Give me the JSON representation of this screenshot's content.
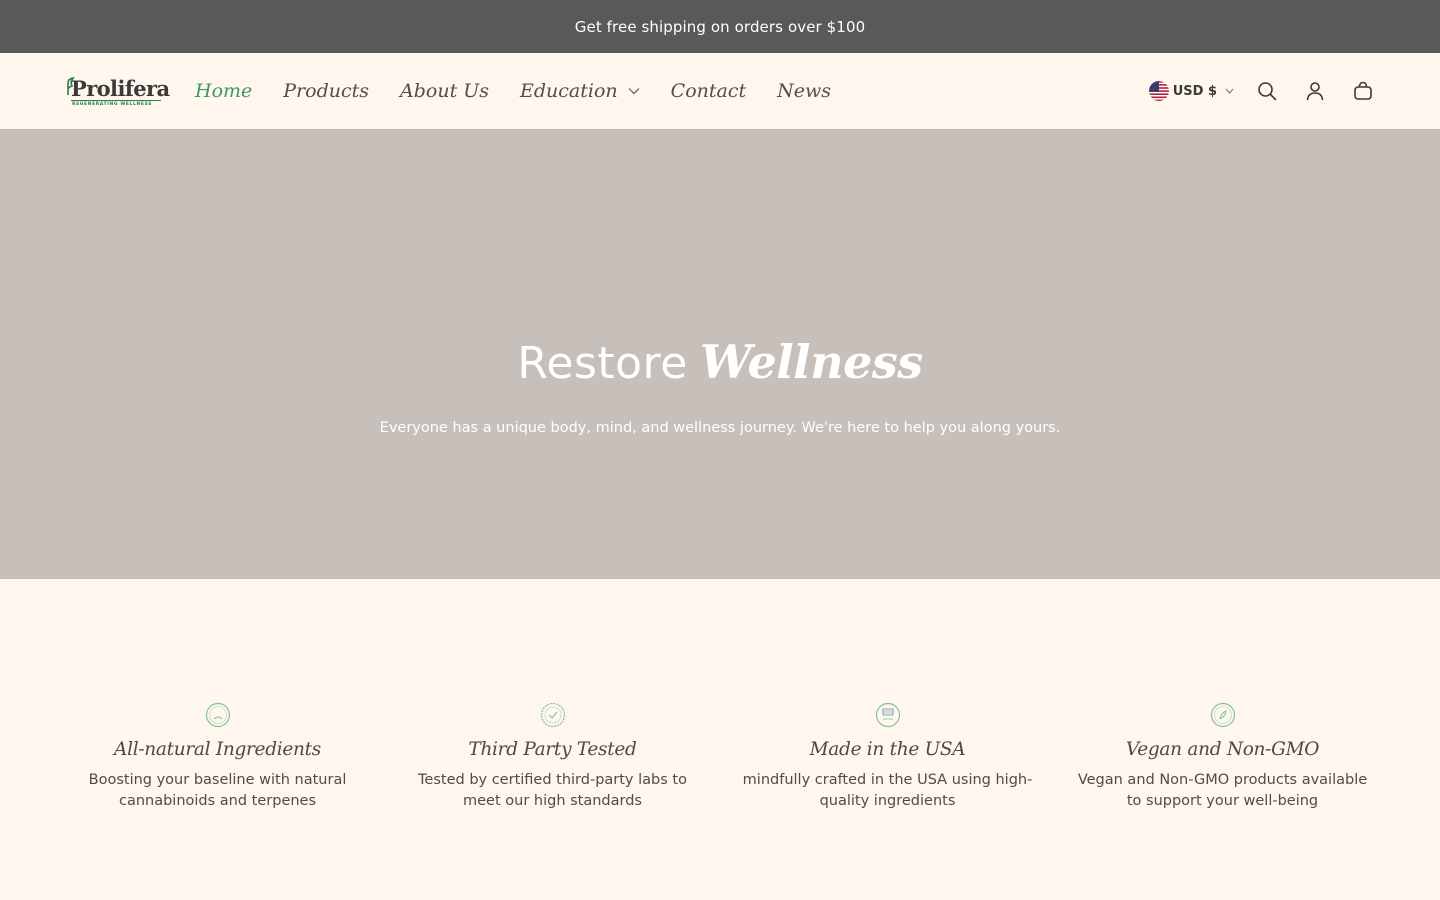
{
  "announcement": {
    "text": "Get free shipping on orders over $100"
  },
  "brand": {
    "name": "Prolifera",
    "tagline": "REGENERATING WELLNESS"
  },
  "nav": {
    "items": [
      {
        "label": "Home",
        "active": true
      },
      {
        "label": "Products",
        "active": false
      },
      {
        "label": "About Us",
        "active": false
      },
      {
        "label": "Education",
        "active": false,
        "has_dropdown": true
      },
      {
        "label": "Contact",
        "active": false
      },
      {
        "label": "News",
        "active": false
      }
    ]
  },
  "currency": {
    "label": "USD $",
    "flag": "us-flag-icon"
  },
  "icons": {
    "search": "search-icon",
    "account": "user-icon",
    "cart": "bag-icon"
  },
  "hero": {
    "title_plain": "Restore",
    "title_italic": "Wellness",
    "subtitle": "Everyone has a unique body, mind, and wellness journey. We're here to help you along yours."
  },
  "features": [
    {
      "title": "All-natural Ingredients",
      "description": "Boosting your baseline with natural cannabinoids and terpenes",
      "icon": "all-natural-badge-icon"
    },
    {
      "title": "Third Party Tested",
      "description": "Tested by certified third-party labs to meet our high standards",
      "icon": "third-party-tested-badge-icon"
    },
    {
      "title": "Made in the USA",
      "description": "mindfully crafted in the USA using high-quality ingredients",
      "icon": "made-in-usa-badge-icon"
    },
    {
      "title": "Vegan and Non-GMO",
      "description": "Vegan and Non-GMO products available to support your well-being",
      "icon": "vegan-badge-icon"
    }
  ],
  "colors": {
    "announcement_bg": "#58595b",
    "page_bg": "#fff6ed",
    "hero_bg": "#c7bfb9",
    "accent_green": "#3c9a5f",
    "text": "#4a4a4a"
  }
}
